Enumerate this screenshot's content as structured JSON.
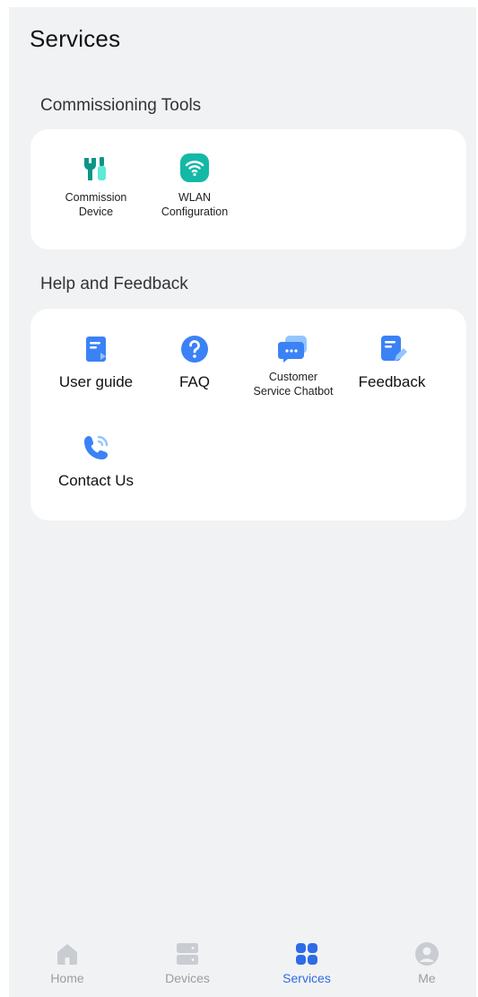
{
  "header": {
    "title": "Services"
  },
  "sections": [
    {
      "title": "Commissioning Tools",
      "items": [
        {
          "label": "Commission\nDevice",
          "icon": "tools-icon",
          "color": "#14b8a6"
        },
        {
          "label": "WLAN\nConfiguration",
          "icon": "wifi-icon",
          "color": "#14b8a6"
        }
      ]
    },
    {
      "title": "Help and Feedback",
      "items": [
        {
          "label": "User guide",
          "icon": "user-guide-icon",
          "color": "#3b82f6"
        },
        {
          "label": "FAQ",
          "icon": "question-icon",
          "color": "#3b82f6"
        },
        {
          "label": "Customer\nService Chatbot",
          "icon": "chatbot-icon",
          "color": "#3b82f6"
        },
        {
          "label": "Feedback",
          "icon": "feedback-icon",
          "color": "#3b82f6"
        },
        {
          "label": "Contact Us",
          "icon": "phone-icon",
          "color": "#3b82f6"
        }
      ]
    }
  ],
  "tabbar": {
    "items": [
      {
        "label": "Home",
        "icon": "home-icon",
        "active": false
      },
      {
        "label": "Devices",
        "icon": "devices-icon",
        "active": false
      },
      {
        "label": "Services",
        "icon": "services-icon",
        "active": true
      },
      {
        "label": "Me",
        "icon": "profile-icon",
        "active": false
      }
    ],
    "active_color": "#2e6be6",
    "inactive_color": "#9a9da3"
  }
}
